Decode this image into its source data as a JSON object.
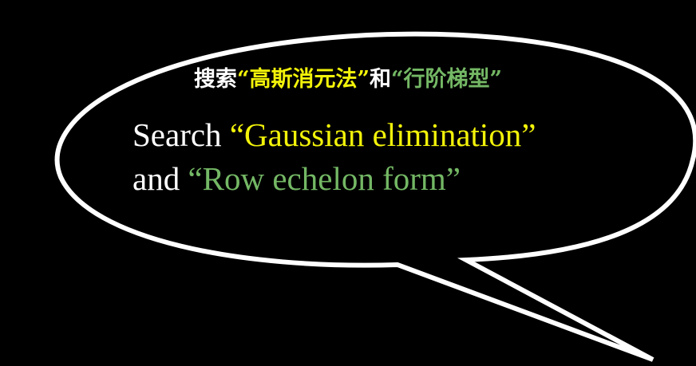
{
  "colors": {
    "background": "#000000",
    "outline": "#ffffff",
    "plain_text": "#ffffff",
    "highlight_yellow": "#f2f20a",
    "highlight_green": "#74b865"
  },
  "bubble": {
    "icon": "speech-bubble-icon"
  },
  "chinese_line": {
    "prefix": "搜索",
    "term1": "“高斯消元法”",
    "connector": "和",
    "term2": "“行阶梯型”"
  },
  "english_line1": {
    "prefix": "Search ",
    "term1": "“Gaussian elimination”"
  },
  "english_line2": {
    "prefix": "and ",
    "term2": "“Row echelon form”"
  }
}
